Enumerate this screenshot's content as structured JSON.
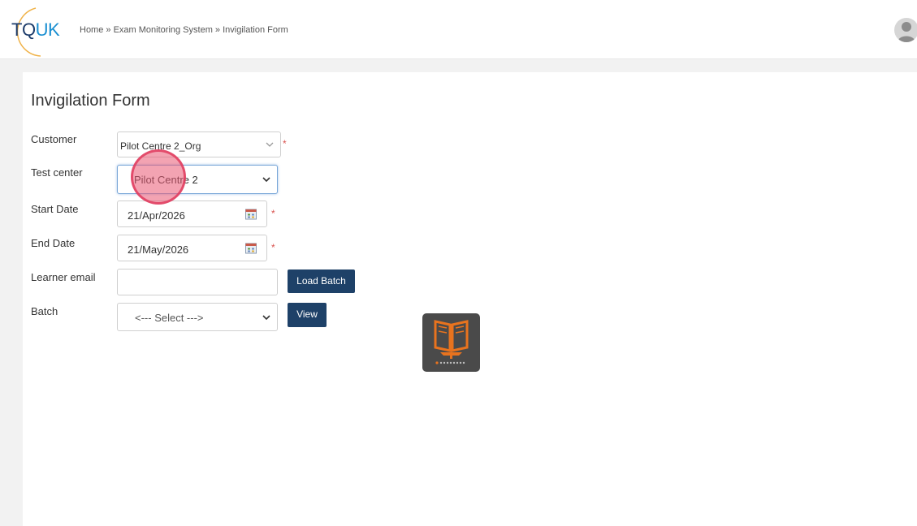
{
  "header": {
    "logo_text_main": "TQ",
    "logo_text_accent": "UK",
    "breadcrumb": {
      "home": "Home",
      "separator": "»",
      "section": "Exam Monitoring System",
      "current": "Invigilation Form"
    }
  },
  "form": {
    "title": "Invigilation Form",
    "fields": {
      "customer": {
        "label": "Customer",
        "value": "Pilot Centre 2_Org",
        "required_mark": "*"
      },
      "test_center": {
        "label": "Test center",
        "value": "Pilot Centre 2"
      },
      "start_date": {
        "label": "Start Date",
        "value": "21/Apr/2026",
        "required_mark": "*"
      },
      "end_date": {
        "label": "End Date",
        "value": "21/May/2026",
        "required_mark": "*"
      },
      "learner_email": {
        "label": "Learner email",
        "value": ""
      },
      "batch": {
        "label": "Batch",
        "value": "<--- Select --->"
      }
    },
    "buttons": {
      "load_batch": "Load Batch",
      "view": "View"
    }
  },
  "colors": {
    "button_bg": "#1e4168",
    "required": "#d9534f",
    "focus_border": "#7aa7d8",
    "logo_navy": "#1d3c6b",
    "logo_blue": "#1a8fd1",
    "loader_bg": "#4a4a4a",
    "loader_accent": "#e8731e"
  },
  "icons": {
    "avatar": "user-avatar-icon",
    "calendar": "calendar-icon",
    "dropdown": "chevron-down-icon",
    "loader": "book-loading-icon"
  }
}
